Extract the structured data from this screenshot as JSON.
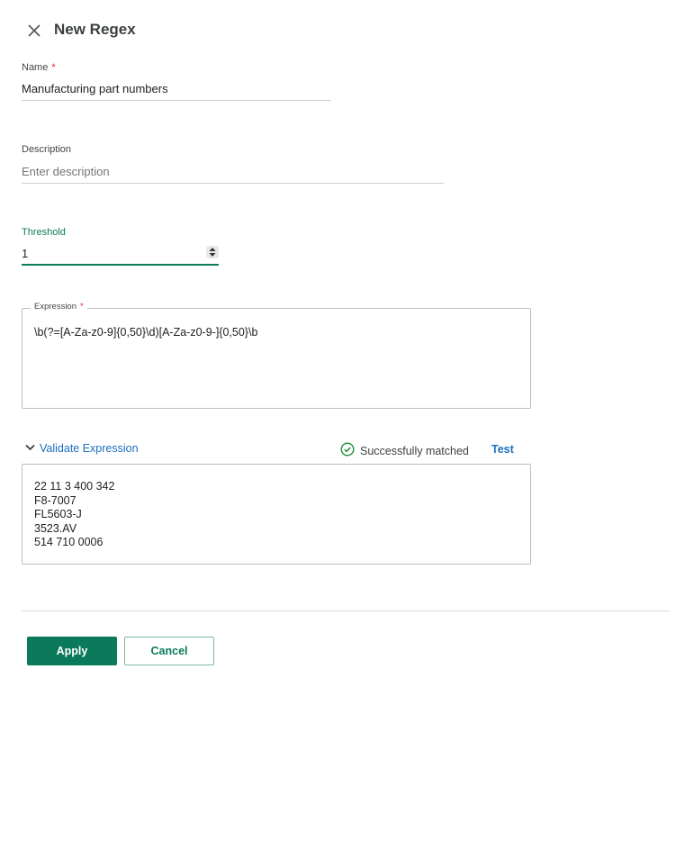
{
  "header": {
    "title": "New Regex",
    "close_icon": "close-icon"
  },
  "name_field": {
    "label": "Name",
    "required_mark": "*",
    "value": "Manufacturing part numbers"
  },
  "description_field": {
    "label": "Description",
    "placeholder": "Enter description",
    "value": ""
  },
  "threshold_field": {
    "label": "Threshold",
    "value": "1",
    "stepper_icon": "stepper-arrows-icon"
  },
  "expression_field": {
    "label": "Expression",
    "required_mark": "*",
    "value": "\\b(?=[A-Za-z0-9]{0,50}\\d)[A-Za-z0-9-]{0,50}\\b"
  },
  "validate": {
    "toggle_label": "Validate Expression",
    "toggle_icon": "chevron-down-icon",
    "status_text": "Successfully matched",
    "status_icon": "check-circle-icon",
    "test_label": "Test",
    "test_lines": [
      "22 11 3 400 342",
      "F8-7007",
      "FL5603-J",
      "3523.AV",
      "514 710 0006"
    ]
  },
  "actions": {
    "apply_label": "Apply",
    "cancel_label": "Cancel"
  },
  "colors": {
    "accent_green": "#0b7a5b",
    "link_blue": "#1a6fc0",
    "required_red": "#d32f2f"
  }
}
